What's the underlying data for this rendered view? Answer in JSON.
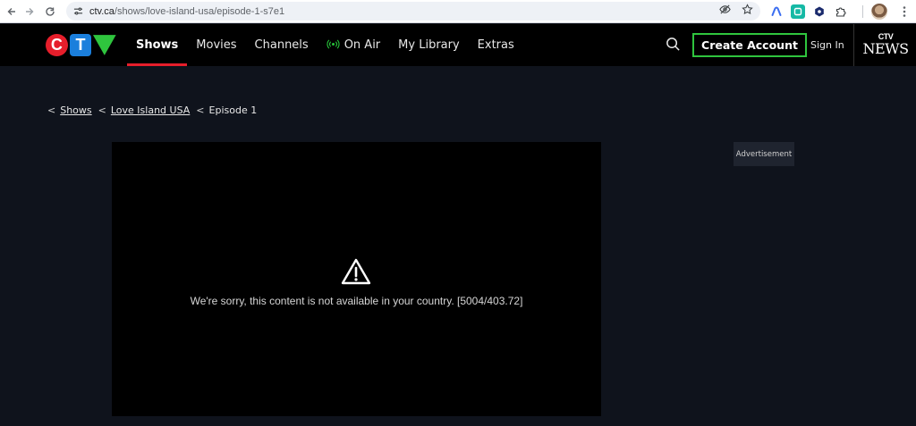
{
  "browser": {
    "url_host": "ctv.ca",
    "url_path": "/shows/love-island-usa/episode-1-s7e1"
  },
  "header": {
    "logo": {
      "c": "C",
      "t": "T",
      "v": "V"
    },
    "nav": [
      {
        "label": "Shows",
        "active": true
      },
      {
        "label": "Movies"
      },
      {
        "label": "Channels"
      },
      {
        "label": "On Air",
        "icon": "broadcast-icon"
      },
      {
        "label": "My Library"
      },
      {
        "label": "Extras"
      }
    ],
    "create_account": "Create Account",
    "sign_in": "Sign In",
    "news_logo": {
      "top": "CTV",
      "bottom": "NEWS"
    }
  },
  "breadcrumb": {
    "items": [
      "Shows",
      "Love Island USA"
    ],
    "current": "Episode 1"
  },
  "player": {
    "message": "We're sorry, this content is not available in your country. [5004/403.72]"
  },
  "ad": {
    "label": "Advertisement"
  },
  "colors": {
    "background": "#0f131c",
    "header": "#000000",
    "accent_red": "#e61e2b",
    "accent_green": "#2fc53e",
    "ctv_blue": "#1b7fdc"
  }
}
